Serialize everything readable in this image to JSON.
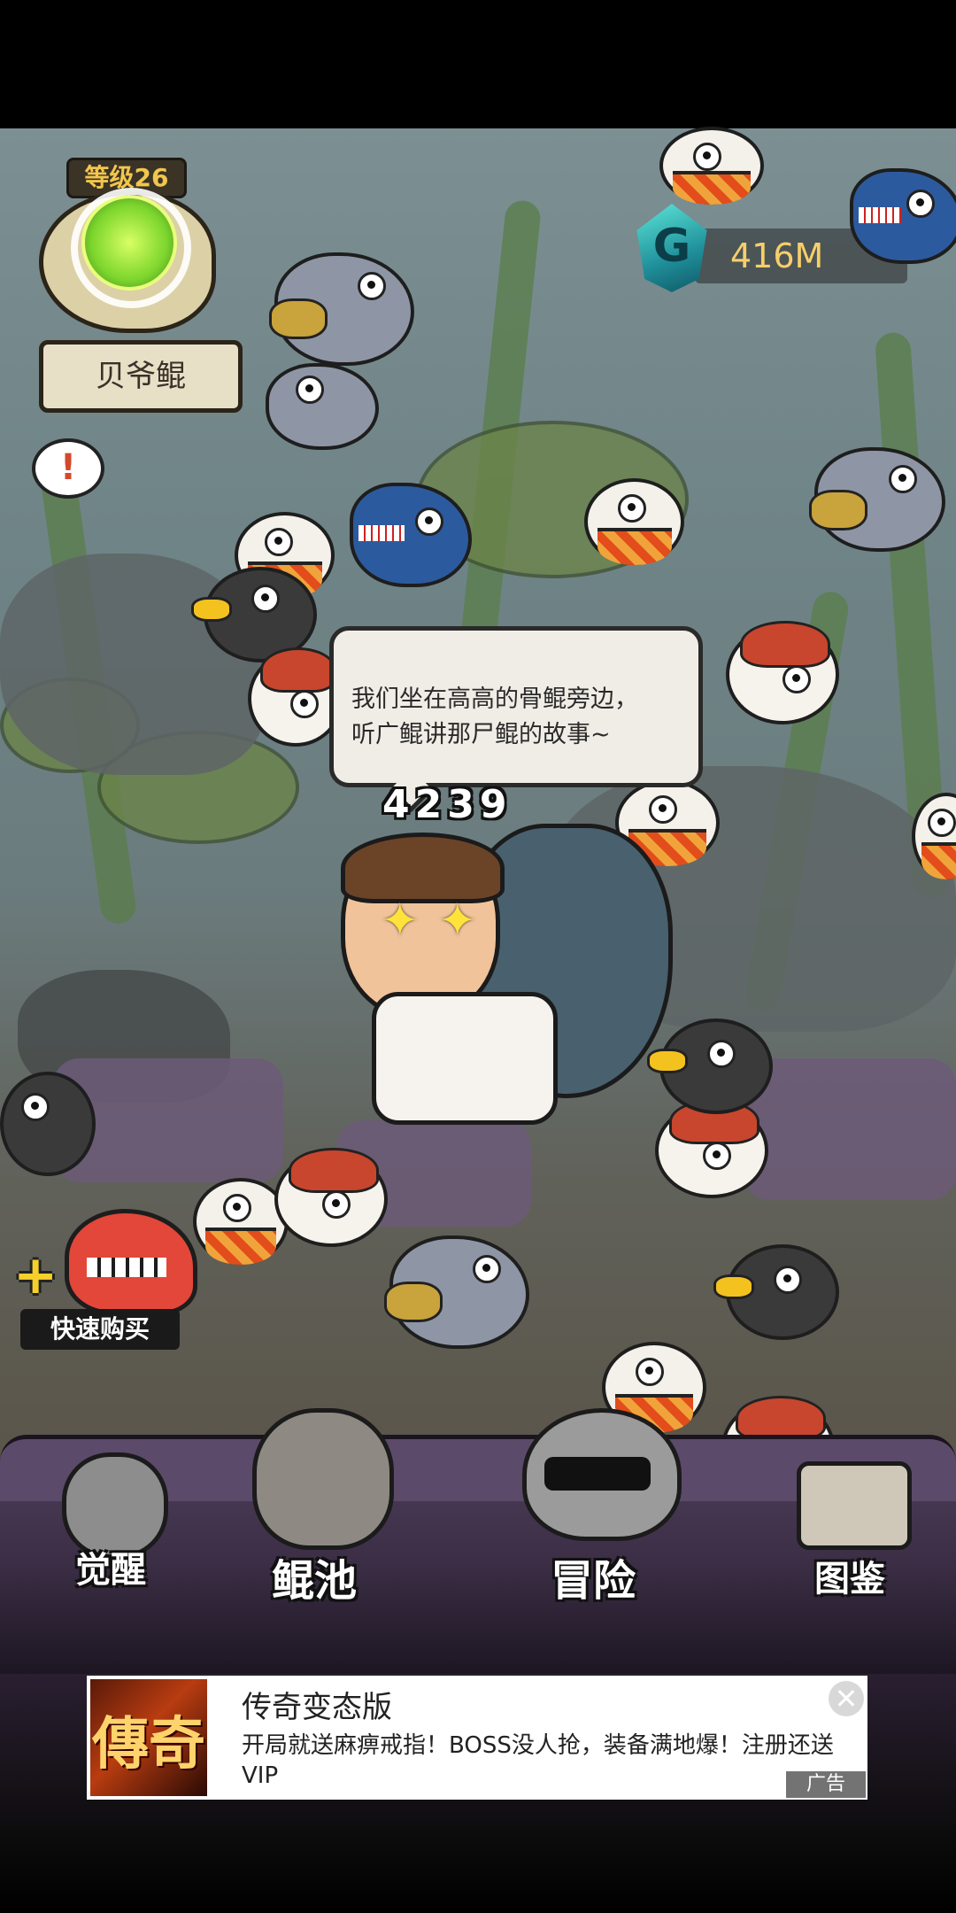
{
  "hud": {
    "level": "等级26",
    "name": "贝爷鲲",
    "alert": "!",
    "currency_icon": "G",
    "currency": "416M"
  },
  "dialog": {
    "line1": "我们坐在高高的骨鲲旁边，",
    "line2": "听广鲲讲那尸鲲的故事~"
  },
  "score": "4239",
  "quick_buy": {
    "plus": "+",
    "label": "快速购买"
  },
  "nav": {
    "awaken": "觉醒",
    "pool": "鲲池",
    "adventure": "冒险",
    "codex": "图鉴"
  },
  "ad": {
    "logo_text": "傳奇",
    "title": "传奇变态版",
    "description": "开局就送麻痹戒指！BOSS没人抢，装备满地爆！注册还送VIP",
    "close": "✕",
    "tag": "广告"
  },
  "colors": {
    "currency_text": "#f6cf6a",
    "level_text": "#f2c64d",
    "nav_bg": "#4d3d59",
    "quick_buy_monster": "#e2473a"
  }
}
